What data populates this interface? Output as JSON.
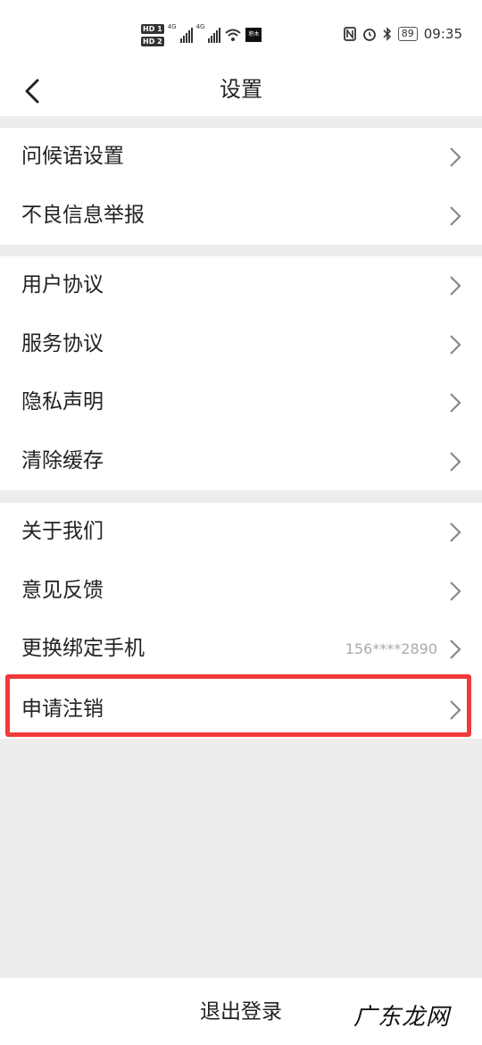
{
  "status_bar": {
    "hd1": "HD 1",
    "hd2": "HD 2",
    "net1": "4G",
    "net2": "4G",
    "app_badge": "积木",
    "battery": "89",
    "time": "09:35"
  },
  "header": {
    "title": "设置"
  },
  "groups": [
    {
      "items": [
        {
          "label": "问候语设置"
        },
        {
          "label": "不良信息举报"
        }
      ]
    },
    {
      "items": [
        {
          "label": "用户协议"
        },
        {
          "label": "服务协议"
        },
        {
          "label": "隐私声明"
        },
        {
          "label": "清除缓存"
        }
      ]
    },
    {
      "items": [
        {
          "label": "关于我们"
        },
        {
          "label": "意见反馈"
        },
        {
          "label": "更换绑定手机",
          "value": "156****2890"
        },
        {
          "label": "申请注销"
        }
      ]
    }
  ],
  "footer": {
    "logout_label": "退出登录"
  },
  "watermark": {
    "text": "广东龙网"
  },
  "colors": {
    "highlight": "#f23a3a",
    "background": "#ededed"
  }
}
